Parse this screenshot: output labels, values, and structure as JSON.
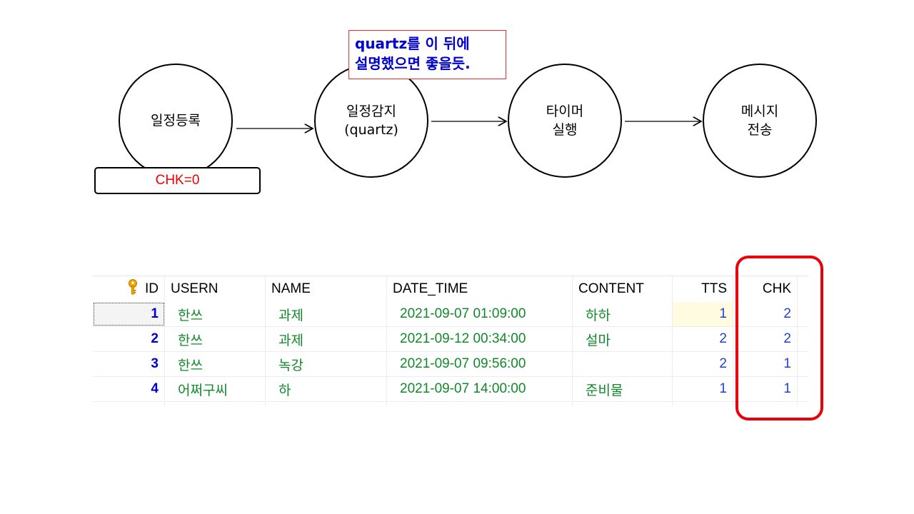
{
  "flow": {
    "nodes": [
      {
        "label": "일정등록"
      },
      {
        "label": "일정감지\n(quartz)"
      },
      {
        "label": "타이머\n실행"
      },
      {
        "label": "메시지\n전송"
      }
    ],
    "status_box": "CHK=0",
    "note": "quartz를 이 뒤에\n설명했으면 좋을듯."
  },
  "table": {
    "columns": [
      "ID",
      "USERN",
      "NAME",
      "DATE_TIME",
      "CONTENT",
      "TTS",
      "CHK"
    ],
    "rows": [
      {
        "id": "1",
        "usern": "한쓰",
        "name": "과제",
        "date_time": "2021-09-07 01:09:00",
        "content": "하하",
        "tts": "1",
        "chk": "2"
      },
      {
        "id": "2",
        "usern": "한쓰",
        "name": "과제",
        "date_time": "2021-09-12 00:34:00",
        "content": "설마",
        "tts": "2",
        "chk": "2"
      },
      {
        "id": "3",
        "usern": "한쓰",
        "name": "녹강",
        "date_time": "2021-09-07 09:56:00",
        "content": "",
        "tts": "2",
        "chk": "1"
      },
      {
        "id": "4",
        "usern": "어쩌구씨",
        "name": "하",
        "date_time": "2021-09-07 14:00:00",
        "content": "준비물",
        "tts": "1",
        "chk": "1"
      }
    ],
    "primary_key_icon": "key-icon",
    "highlight_color": "#e8000d"
  }
}
